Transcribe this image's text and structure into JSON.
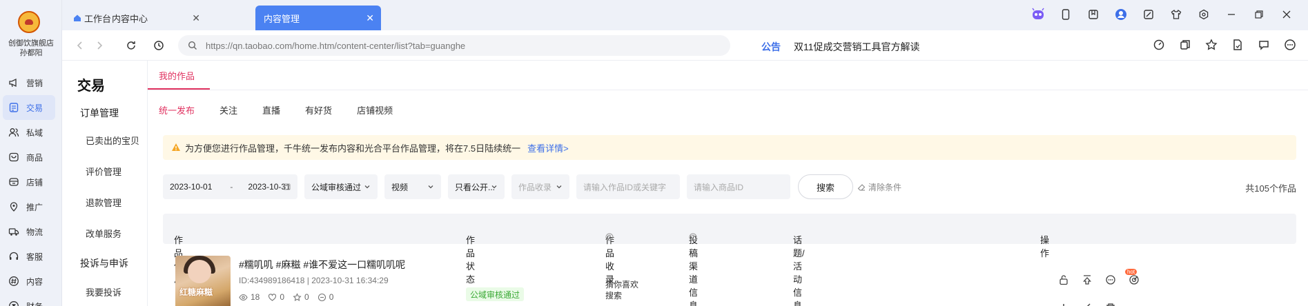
{
  "app": {
    "store_name_line1": "创御饮旗舰店",
    "store_name_line2": "孙都阳",
    "nav": [
      {
        "label": "营销",
        "icon": "megaphone-icon"
      },
      {
        "label": "交易",
        "icon": "document-icon"
      },
      {
        "label": "私域",
        "icon": "users-icon"
      },
      {
        "label": "商品",
        "icon": "product-icon"
      },
      {
        "label": "店铺",
        "icon": "shop-icon"
      },
      {
        "label": "推广",
        "icon": "location-icon"
      },
      {
        "label": "物流",
        "icon": "truck-icon"
      },
      {
        "label": "客服",
        "icon": "headset-icon"
      },
      {
        "label": "内容",
        "icon": "hash-icon"
      },
      {
        "label": "财务",
        "icon": "finance-icon"
      }
    ],
    "active_nav": "交易",
    "accent": "#3d6fe8"
  },
  "browser": {
    "tabs": [
      {
        "label": "工作台"
      },
      {
        "label": "内容中心"
      },
      {
        "label": "内容管理"
      }
    ],
    "url": "https://qn.taobao.com/home.htm/content-center/list?tab=guanghe",
    "notice_label": "公告",
    "notice_text": "双11促成交营销工具官方解读"
  },
  "subnav": {
    "heading": "交易",
    "groups": [
      {
        "label": "订单管理",
        "items": [
          "已卖出的宝贝",
          "评价管理",
          "退款管理",
          "改单服务"
        ]
      },
      {
        "label": "投诉与申诉",
        "items": [
          "我要投诉"
        ]
      }
    ]
  },
  "content": {
    "top_tab": "我的作品",
    "sub_tabs": [
      "统一发布",
      "关注",
      "直播",
      "有好货",
      "店铺视频"
    ],
    "active_sub_tab": "统一发布",
    "banner_text": "为方便您进行作品管理，千牛统一发布内容和光合平台作品管理，将在7.5日陆续统一",
    "banner_link": "查看详情>",
    "filters": {
      "date_start": "2023-10-01",
      "date_sep": "-",
      "date_end": "2023-10-31",
      "audit_status": "公域审核通过",
      "type": "视频",
      "visibility": "只看公开...",
      "inclusion_placeholder": "作品收录",
      "keyword_placeholder": "请输入作品ID或关键字",
      "product_placeholder": "请输入商品ID",
      "search_label": "搜索",
      "clear_label": "清除条件",
      "total": "共105个作品"
    },
    "table": {
      "headers": [
        "作品信息",
        "作品状态",
        "作品收录",
        "投稿渠道信息",
        "话题/活动信息",
        "操作"
      ],
      "rows": [
        {
          "thumb_caption": "红糖麻糍",
          "title": "#糯叽叽 #麻糍 #谁不爱这一口糯叽叽呢",
          "meta": "ID:434989186418 | 2023-10-31 16:34:29",
          "views": "18",
          "likes": "0",
          "favorites": "0",
          "comments": "0",
          "status": "公域审核通过",
          "inclusion": [
            "猜你喜欢",
            "搜索"
          ],
          "hot_badge": "hot"
        }
      ]
    },
    "accent": "#e0315f"
  }
}
